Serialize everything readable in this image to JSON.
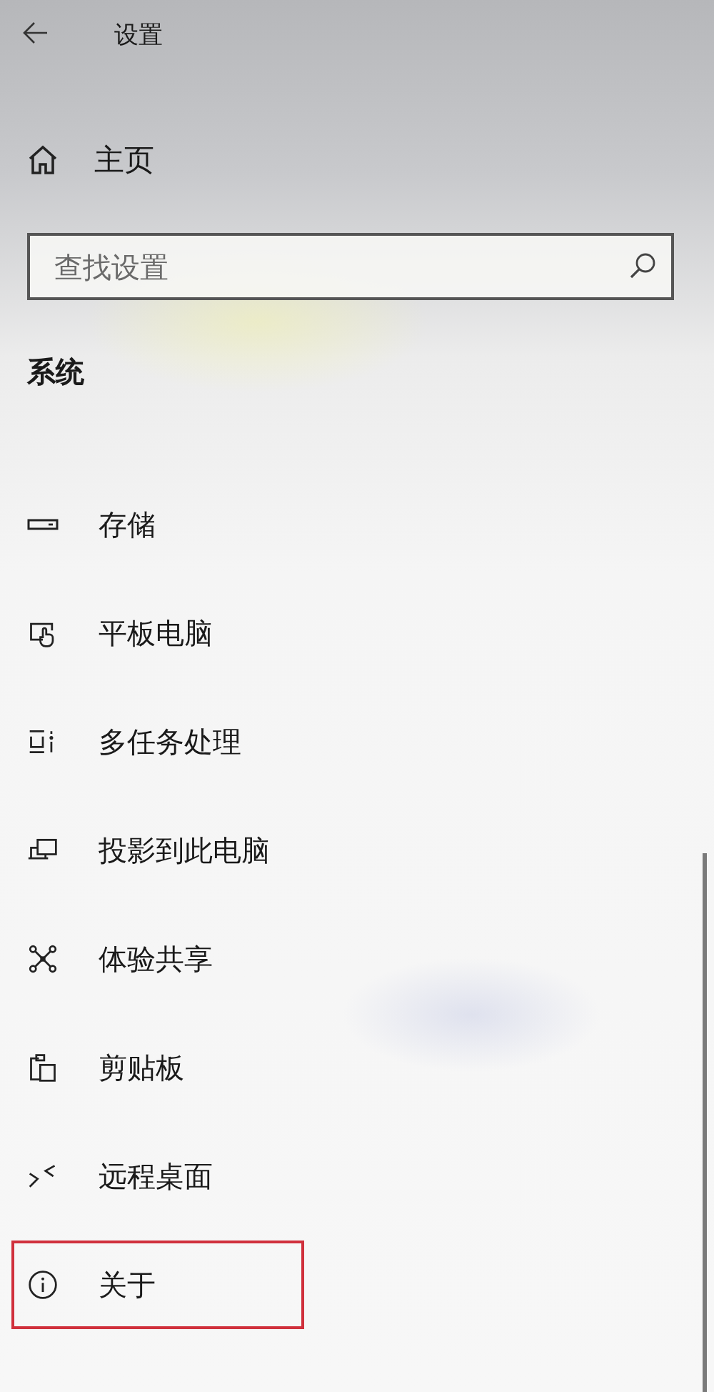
{
  "window": {
    "title": "设置"
  },
  "home": {
    "label": "主页"
  },
  "search": {
    "placeholder": "查找设置"
  },
  "section": {
    "title": "系统"
  },
  "items": [
    {
      "label": "存储",
      "highlighted": false
    },
    {
      "label": "平板电脑",
      "highlighted": false
    },
    {
      "label": "多任务处理",
      "highlighted": false
    },
    {
      "label": "投影到此电脑",
      "highlighted": false
    },
    {
      "label": "体验共享",
      "highlighted": false
    },
    {
      "label": "剪贴板",
      "highlighted": false
    },
    {
      "label": "远程桌面",
      "highlighted": false
    },
    {
      "label": "关于",
      "highlighted": true
    }
  ]
}
